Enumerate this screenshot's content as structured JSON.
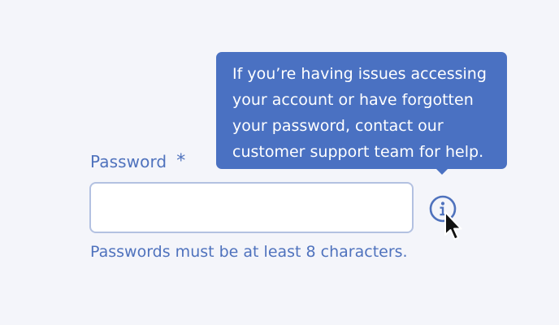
{
  "form": {
    "password_label": "Password",
    "required_marker": "*",
    "password_value": "",
    "help_text": "Passwords must be at least 8 characters."
  },
  "tooltip": {
    "lines": [
      "If you’re having issues accessing",
      "your account or have forgotten",
      "your password, contact our",
      "customer support team for help."
    ]
  },
  "icons": {
    "info": "info-icon",
    "cursor": "mouse-pointer-icon"
  },
  "colors": {
    "accent": "#4f72bd",
    "tooltip_background": "#4a71c2",
    "input_border": "#b3c1e1",
    "page_background": "#f4f5fa"
  }
}
